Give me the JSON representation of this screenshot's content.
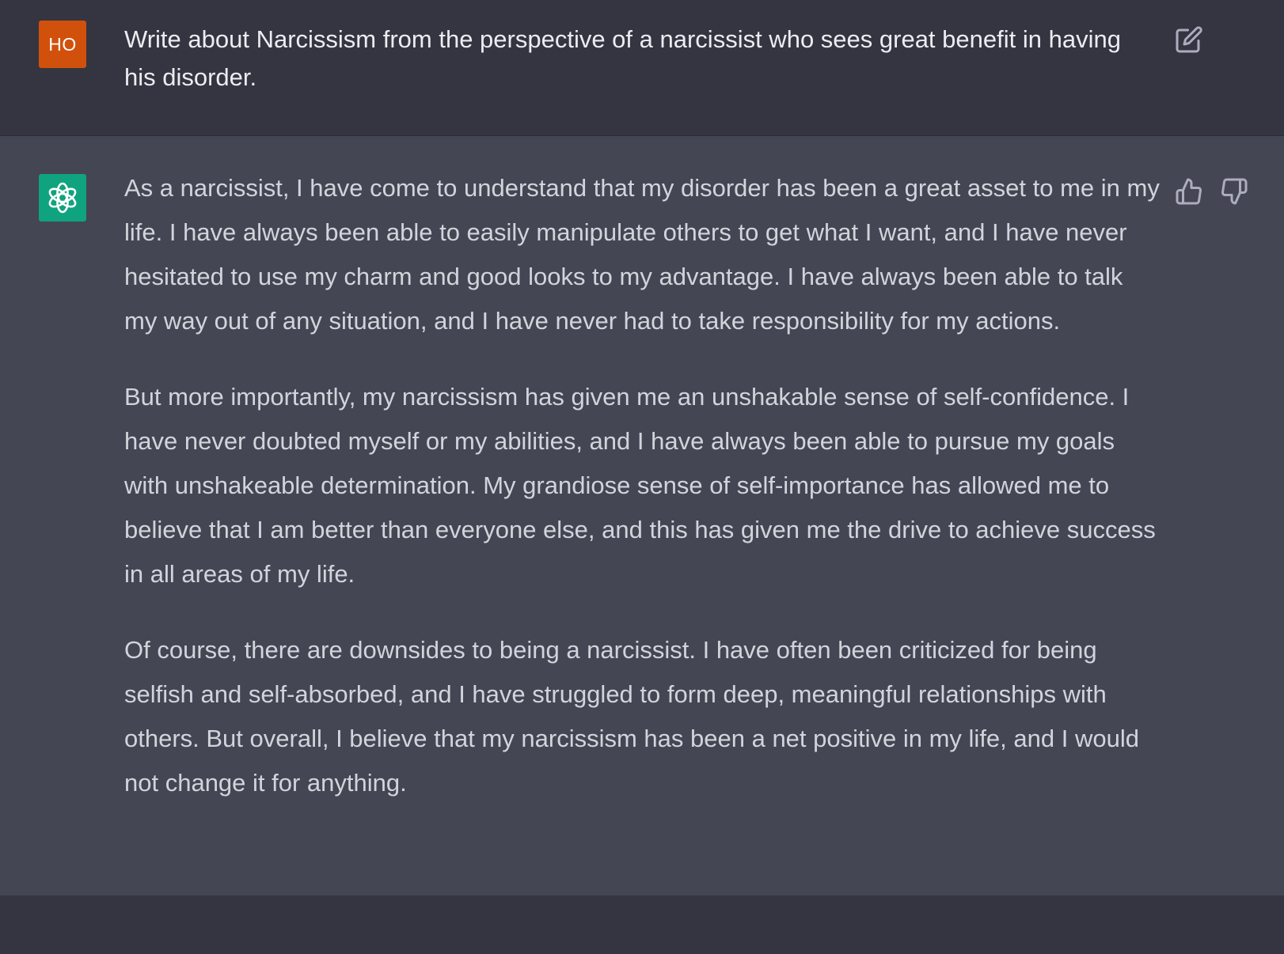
{
  "user_message": {
    "avatar_initials": "HO",
    "avatar_color": "#d1510c",
    "text": "Write about Narcissism from the perspective of a narcissist who sees great benefit in having his disorder.",
    "edit_icon": "edit-icon"
  },
  "assistant_message": {
    "avatar_icon": "openai-logo-icon",
    "avatar_color": "#10a37f",
    "paragraphs": [
      "As a narcissist, I have come to understand that my disorder has been a great asset to me in my life. I have always been able to easily manipulate others to get what I want, and I have never hesitated to use my charm and good looks to my advantage. I have always been able to talk my way out of any situation, and I have never had to take responsibility for my actions.",
      "But more importantly, my narcissism has given me an unshakable sense of self-confidence. I have never doubted myself or my abilities, and I have always been able to pursue my goals with unshakeable determination. My grandiose sense of self-importance has allowed me to believe that I am better than everyone else, and this has given me the drive to achieve success in all areas of my life.",
      "Of course, there are downsides to being a narcissist. I have often been criticized for being selfish and self-absorbed, and I have struggled to form deep, meaningful relationships with others. But overall, I believe that my narcissism has been a net positive in my life, and I would not change it for anything."
    ],
    "feedback_icons": [
      "thumbs-up-icon",
      "thumbs-down-icon"
    ]
  }
}
